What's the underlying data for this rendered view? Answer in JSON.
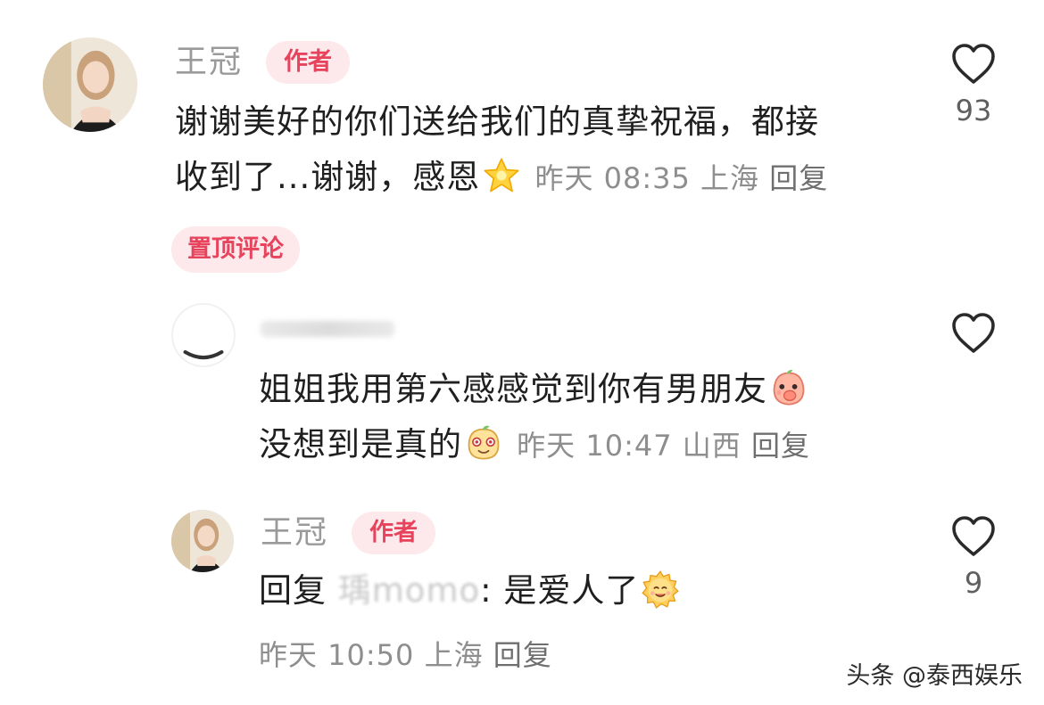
{
  "comments": [
    {
      "author": "王冠",
      "badge": "作者",
      "text_line1": "谢谢美好的你们送给我们的真挚祝福，都接",
      "text_line2_prefix": "收到了...谢谢，感恩",
      "emoji": "star-emoji",
      "time": "昨天 08:35",
      "location": "上海",
      "reply_label": "回复",
      "pinned_label": "置顶评论",
      "likes": "93"
    },
    {
      "author": "",
      "text_line1": "姐姐我用第六感感觉到你有男朋友",
      "line1_emoji": "peach-covering-mouth-emoji",
      "text_line2_prefix": "没想到是真的",
      "line2_emoji": "blushing-peach-emoji",
      "time": "昨天 10:47",
      "location": "山西",
      "reply_label": "回复",
      "likes": ""
    },
    {
      "author": "王冠",
      "badge": "作者",
      "reply_prefix": "回复",
      "reply_target": "瑀momo",
      "reply_text": ": 是爱人了",
      "emoji": "smiling-sun-emoji",
      "time": "昨天 10:50",
      "location": "上海",
      "reply_label": "回复",
      "likes": "9"
    }
  ],
  "watermark": "头条 @泰西娱乐",
  "colors": {
    "accent": "#e8435c",
    "badge_bg": "#fde9ec",
    "meta_text": "#8e8e8e"
  }
}
